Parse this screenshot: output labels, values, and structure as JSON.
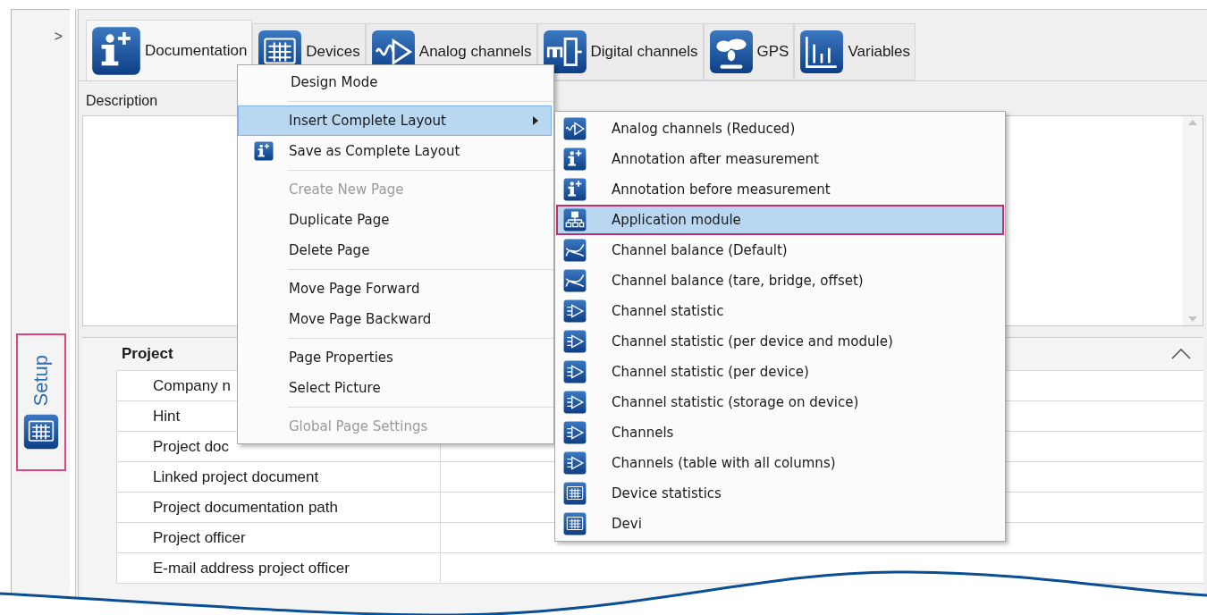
{
  "sidebar": {
    "expand_glyph": ">",
    "tabs": [
      {
        "label": "Setup",
        "selected": true
      }
    ]
  },
  "tabs": [
    {
      "label": "Documentation",
      "kind": "info",
      "selected": true
    },
    {
      "label": "Devices",
      "kind": "devices",
      "selected": false
    },
    {
      "label": "Analog channels",
      "kind": "analog",
      "selected": false
    },
    {
      "label": "Digital channels",
      "kind": "digital",
      "selected": false
    },
    {
      "label": "GPS",
      "kind": "gps",
      "selected": false
    },
    {
      "label": "Variables",
      "kind": "variables",
      "selected": false
    }
  ],
  "description": {
    "label": "Description"
  },
  "property_grid": {
    "category": "Project",
    "expanded": true,
    "rows": [
      {
        "label": "Company n"
      },
      {
        "label": "Hint"
      },
      {
        "label": "Project doc"
      },
      {
        "label": "Linked project document"
      },
      {
        "label": "Project documentation path"
      },
      {
        "label": "Project officer"
      },
      {
        "label": "E-mail address project officer"
      }
    ]
  },
  "context_menu": {
    "groups": [
      [
        {
          "label": "Design Mode",
          "disabled": false,
          "selected": false
        }
      ],
      [
        {
          "label": "Insert Complete Layout",
          "disabled": false,
          "selected": true,
          "submenu": true
        },
        {
          "label": "Save as Complete Layout",
          "disabled": false,
          "selected": false,
          "kind": "info"
        }
      ],
      [
        {
          "label": "Create New Page",
          "disabled": true,
          "selected": false
        },
        {
          "label": "Duplicate Page",
          "disabled": false,
          "selected": false
        },
        {
          "label": "Delete Page",
          "disabled": false,
          "selected": false
        }
      ],
      [
        {
          "label": "Move Page Forward",
          "disabled": false,
          "selected": false
        },
        {
          "label": "Move Page Backward",
          "disabled": false,
          "selected": false
        }
      ],
      [
        {
          "label": "Page Properties",
          "disabled": false,
          "selected": false
        },
        {
          "label": "Select Picture",
          "disabled": false,
          "selected": false
        }
      ],
      [
        {
          "label": "Global Page Settings",
          "disabled": true,
          "selected": false
        }
      ]
    ]
  },
  "submenu": {
    "items": [
      {
        "label": "Analog channels (Reduced)",
        "kind": "analog",
        "selected": false
      },
      {
        "label": "Annotation after measurement",
        "kind": "info",
        "selected": false
      },
      {
        "label": "Annotation before measurement",
        "kind": "info",
        "selected": false
      },
      {
        "label": "Application module",
        "kind": "module",
        "selected": true
      },
      {
        "label": "Channel balance (Default)",
        "kind": "balance",
        "selected": false
      },
      {
        "label": "Channel balance (tare, bridge, offset)",
        "kind": "balance",
        "selected": false
      },
      {
        "label": "Channel statistic",
        "kind": "statistic",
        "selected": false
      },
      {
        "label": "Channel statistic (per device and module)",
        "kind": "statistic",
        "selected": false
      },
      {
        "label": "Channel statistic (per device)",
        "kind": "statistic",
        "selected": false
      },
      {
        "label": "Channel statistic (storage on device)",
        "kind": "statistic",
        "selected": false
      },
      {
        "label": "Channels",
        "kind": "statistic",
        "selected": false
      },
      {
        "label": "Channels (table with all columns)",
        "kind": "statistic",
        "selected": false
      },
      {
        "label": "Device statistics",
        "kind": "device",
        "selected": false
      },
      {
        "label": "Devi",
        "kind": "device",
        "selected": false
      }
    ]
  }
}
